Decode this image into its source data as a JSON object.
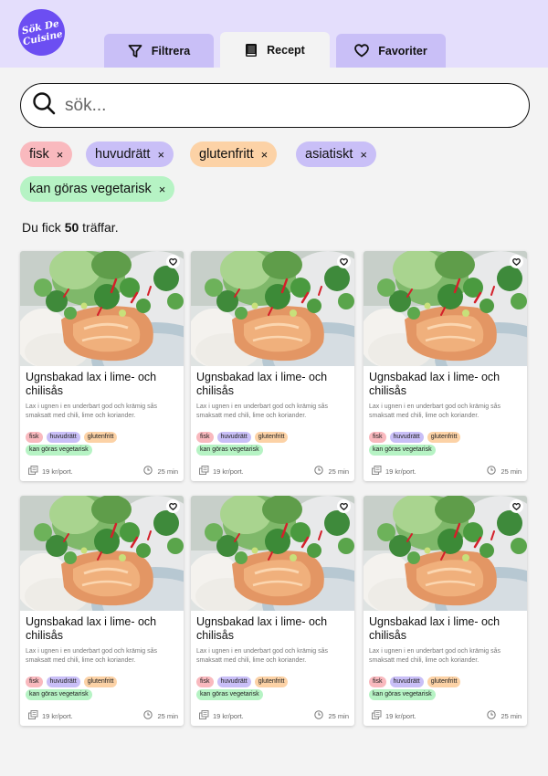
{
  "app": {
    "logo_line1": "Sök De",
    "logo_line2": "Cuisine"
  },
  "tabs": [
    {
      "label": "Filtrera",
      "icon": "filter-icon"
    },
    {
      "label": "Recept",
      "icon": "book-icon",
      "active": true
    },
    {
      "label": "Favoriter",
      "icon": "heart-icon"
    }
  ],
  "search": {
    "placeholder": "sök...",
    "value": ""
  },
  "active_filters": [
    {
      "label": "fisk",
      "color": "#f9b9be"
    },
    {
      "label": "huvudrätt",
      "color": "#c9bff7"
    },
    {
      "label": "glutenfritt",
      "color": "#fcd2a6"
    },
    {
      "label": "asiatiskt",
      "color": "#c9bff7"
    },
    {
      "label": "kan göras vegetarisk",
      "color": "#b6f3c4"
    }
  ],
  "remove_symbol": "×",
  "results": {
    "prefix": "Du fick",
    "count": "50",
    "suffix": "träffar."
  },
  "colors": {
    "accent": "#6c4ef2",
    "header_bg": "#e4defc",
    "tab_bg": "#c9bff7",
    "page_bg": "#f3f3f3"
  },
  "recipes": [
    {
      "title": "Ugnsbakad lax i lime- och chilisås",
      "description": "Lax i ugnen i en underbart god och krämig sås smaksatt med chili, lime och koriander.",
      "tags": [
        "fisk",
        "huvudrätt",
        "glutenfritt",
        "kan göras vegetarisk"
      ],
      "price": "19 kr/port.",
      "time": "25 min"
    },
    {
      "title": "Ugnsbakad lax i lime- och chilisås",
      "description": "Lax i ugnen i en underbart god och krämig sås smaksatt med chili, lime och koriander.",
      "tags": [
        "fisk",
        "huvudrätt",
        "glutenfritt",
        "kan göras vegetarisk"
      ],
      "price": "19 kr/port.",
      "time": "25 min"
    },
    {
      "title": "Ugnsbakad lax i lime- och chilisås",
      "description": "Lax i ugnen i en underbart god och krämig sås smaksatt med chili, lime och koriander.",
      "tags": [
        "fisk",
        "huvudrätt",
        "glutenfritt",
        "kan göras vegetarisk"
      ],
      "price": "19 kr/port.",
      "time": "25 min"
    },
    {
      "title": "Ugnsbakad lax i lime- och chilisås",
      "description": "Lax i ugnen i en underbart god och krämig sås smaksatt med chili, lime och koriander.",
      "tags": [
        "fisk",
        "huvudrätt",
        "glutenfritt",
        "kan göras vegetarisk"
      ],
      "price": "19 kr/port.",
      "time": "25 min"
    },
    {
      "title": "Ugnsbakad lax i lime- och chilisås",
      "description": "Lax i ugnen i en underbart god och krämig sås smaksatt med chili, lime och koriander.",
      "tags": [
        "fisk",
        "huvudrätt",
        "glutenfritt",
        "kan göras vegetarisk"
      ],
      "price": "19 kr/port.",
      "time": "25 min"
    },
    {
      "title": "Ugnsbakad lax i lime- och chilisås",
      "description": "Lax i ugnen i en underbart god och krämig sås smaksatt med chili, lime och koriander.",
      "tags": [
        "fisk",
        "huvudrätt",
        "glutenfritt",
        "kan göras vegetarisk"
      ],
      "price": "19 kr/port.",
      "time": "25 min"
    }
  ]
}
